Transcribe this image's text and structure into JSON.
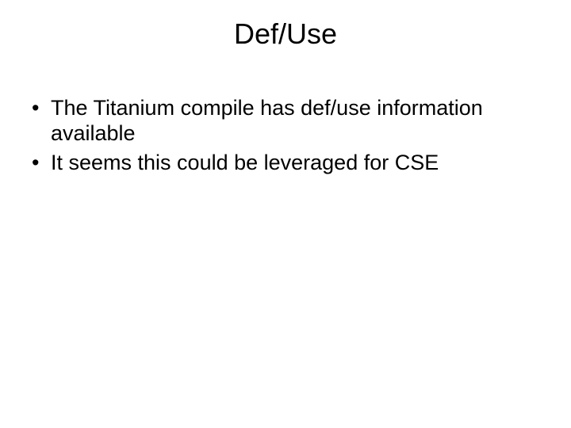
{
  "slide": {
    "title": "Def/Use",
    "bullets": [
      "The Titanium compile has def/use information available",
      "It seems this could be leveraged for CSE"
    ]
  }
}
